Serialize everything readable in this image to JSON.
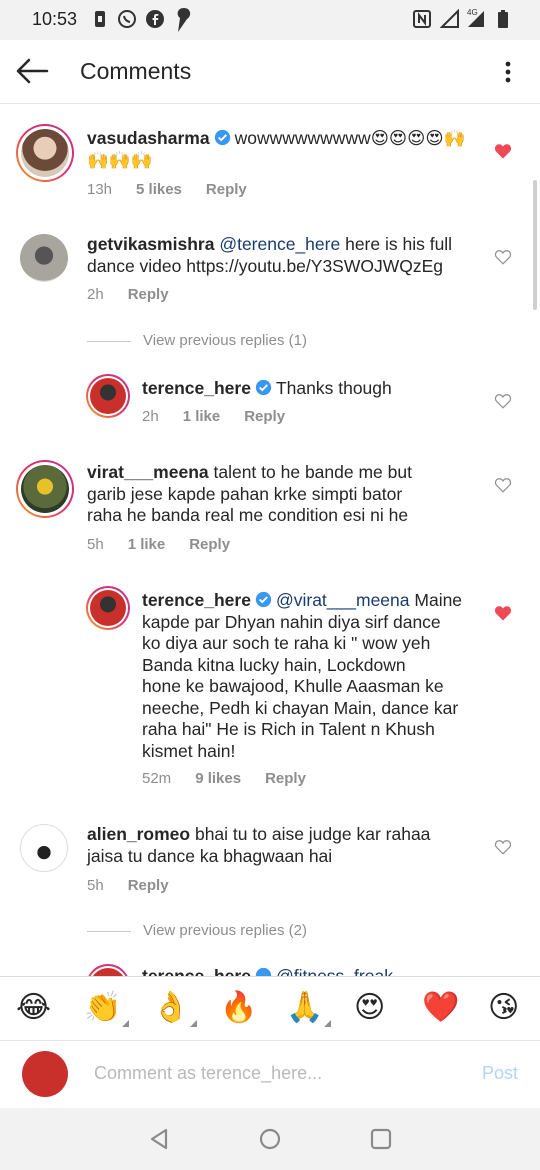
{
  "status_bar": {
    "time": "10:53",
    "network": "4G"
  },
  "header": {
    "title": "Comments"
  },
  "comments": [
    {
      "username": "vasudasharma",
      "text": "wowwwwwwwww😍😍😍😍🙌🙌🙌🙌",
      "time": "13h",
      "likes": "5 likes",
      "reply": "Reply",
      "liked": true
    },
    {
      "username": "getvikasmishra",
      "mention": "@terence_here",
      "text_line1": " here is his full",
      "text_line2": "dance video  https://youtu.be/Y3SWOJWQzEg",
      "time": "2h",
      "reply": "Reply",
      "liked": false
    },
    {
      "view_previous": "View previous replies (1)"
    },
    {
      "username": "terence_here",
      "text": "Thanks though",
      "time": "2h",
      "likes": "1 like",
      "reply": "Reply",
      "liked": false
    },
    {
      "username": "virat___meena",
      "line1": " talent to  he  bande  me  but",
      "line2": "garib jese  kapde  pahan krke  simpti bator",
      "line3": "raha he  banda  real  me  condition esi ni he",
      "time": "5h",
      "likes": "1 like",
      "reply": "Reply",
      "liked": false
    },
    {
      "username": "terence_here",
      "mention": "@virat___meena",
      "line1": " Maine",
      "line2": "kapde par Dhyan nahin diya sirf dance",
      "line3": "ko diya aur soch te raha ki \" wow yeh",
      "line4": "Banda kitna lucky hain, Lockdown",
      "line5": "hone ke bawajood, Khulle Aaasman ke",
      "line6": "neeche, Pedh ki chayan Main, dance kar",
      "line7": "raha hai\" He is Rich in Talent n Khush",
      "line8": "kismet hain!",
      "time": "52m",
      "likes": "9 likes",
      "reply": "Reply",
      "liked": true
    },
    {
      "username": "alien_romeo",
      "line1": " bhai tu to aise judge kar rahaa",
      "line2": "jaisa tu dance ka bhagwaan hai",
      "time": "5h",
      "reply": "Reply",
      "liked": false
    },
    {
      "view_previous": "View previous replies (2)"
    },
    {
      "username": "terence_here",
      "mention": "@fitness_freak"
    }
  ],
  "emoji_bar": [
    "😂",
    "👏",
    "👌",
    "🔥",
    "🙏",
    "😍",
    "❤️",
    "😘"
  ],
  "composer": {
    "placeholder": "Comment as terence_here...",
    "post": "Post"
  },
  "colors": {
    "like_red": "#ed4956",
    "link": "#1a3b6e",
    "post_disabled": "#b3d4f7",
    "verified": "#3897f0"
  }
}
